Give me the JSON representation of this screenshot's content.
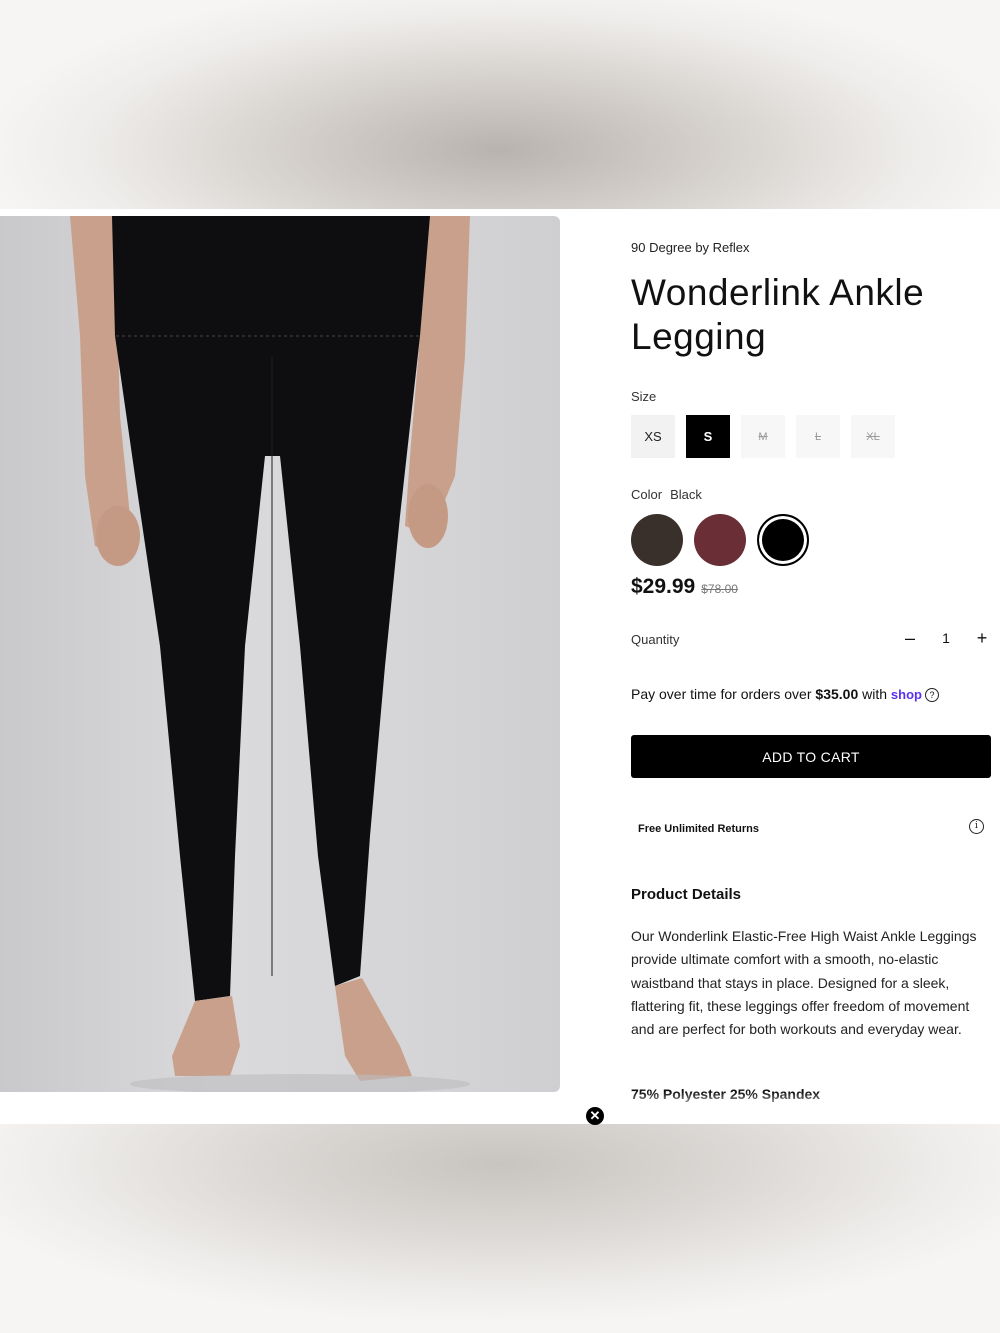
{
  "product": {
    "brand": "90 Degree by Reflex",
    "title": "Wonderlink Ankle Legging",
    "image_alt": "Model wearing black high-waist ankle leggings"
  },
  "size": {
    "label": "Size",
    "options": [
      {
        "label": "XS",
        "state": "available"
      },
      {
        "label": "S",
        "state": "selected"
      },
      {
        "label": "M",
        "state": "unavailable"
      },
      {
        "label": "L",
        "state": "unavailable"
      },
      {
        "label": "XL",
        "state": "unavailable"
      }
    ]
  },
  "color": {
    "label": "Color",
    "selected": "Black",
    "swatches": [
      {
        "name": "brown",
        "hex": "#3a302b"
      },
      {
        "name": "burgundy",
        "hex": "#6a2e37"
      },
      {
        "name": "black",
        "hex": "#000000",
        "selected": true
      }
    ]
  },
  "price": {
    "current": "$29.99",
    "original": "$78.00"
  },
  "quantity": {
    "label": "Quantity",
    "value": "1",
    "decrement": "–",
    "increment": "+"
  },
  "shop_pay": {
    "text": "Pay over time for orders over",
    "amount": "$35.00",
    "with": "with",
    "logo": "shop",
    "help_icon": "question-circle-icon"
  },
  "cart": {
    "label": "ADD TO CART"
  },
  "returns": {
    "label": "Free Unlimited Returns",
    "icon": "info-circle-icon"
  },
  "details": {
    "title": "Product Details",
    "body": "Our Wonderlink Elastic-Free High Waist Ankle Leggings provide ultimate comfort with a smooth, no-elastic waistband that stays in place. Designed for a sleek, flattering fit, these leggings offer freedom of movement and are perfect for both workouts and everyday wear.",
    "fabric": "75% Polyester 25% Spandex"
  },
  "overlay": {
    "close_icon": "close-circle-icon"
  }
}
